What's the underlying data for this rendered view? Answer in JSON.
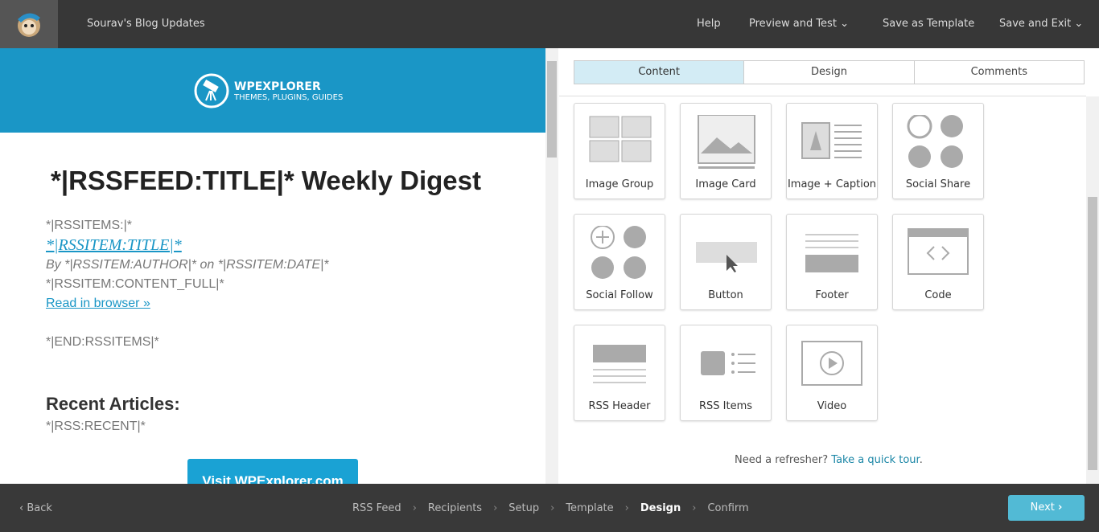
{
  "header": {
    "campaign": "Sourav's Blog Updates",
    "help": "Help",
    "preview": "Preview and Test",
    "save_template": "Save as Template",
    "save_exit": "Save and Exit"
  },
  "email": {
    "logo_title": "WPEXPLORER",
    "logo_sub": "THEMES, PLUGINS, GUIDES",
    "title": "*|RSSFEED:TITLE|* Weekly Digest",
    "rss_items": "*|RSSITEMS:|*",
    "item_title": "*|RSSITEM:TITLE|*",
    "byline": "By *|RSSITEM:AUTHOR|* on *|RSSITEM:DATE|*",
    "content": "*|RSSITEM:CONTENT_FULL|*",
    "read_link": "Read in browser »",
    "end": "*|END:RSSITEMS|*",
    "recent_heading": "Recent Articles:",
    "recent": "*|RSS:RECENT|*",
    "visit_button": "Visit WPExplorer.com"
  },
  "panel": {
    "tabs": [
      "Content",
      "Design",
      "Comments"
    ],
    "active_tab": "Content",
    "blocks": [
      "Image Group",
      "Image Card",
      "Image + Caption",
      "Social Share",
      "Social Follow",
      "Button",
      "Footer",
      "Code",
      "RSS Header",
      "RSS Items",
      "Video"
    ],
    "tour_text": "Need a refresher?",
    "tour_link": "Take a quick tour",
    "tour_end": "."
  },
  "footer": {
    "back": "Back",
    "steps": [
      "RSS Feed",
      "Recipients",
      "Setup",
      "Template",
      "Design",
      "Confirm"
    ],
    "current_step": "Design",
    "next": "Next"
  },
  "colors": {
    "topbar": "#373737",
    "banner": "#1a96c6",
    "next": "#52bad5",
    "active_tab": "#d3ecf5"
  }
}
